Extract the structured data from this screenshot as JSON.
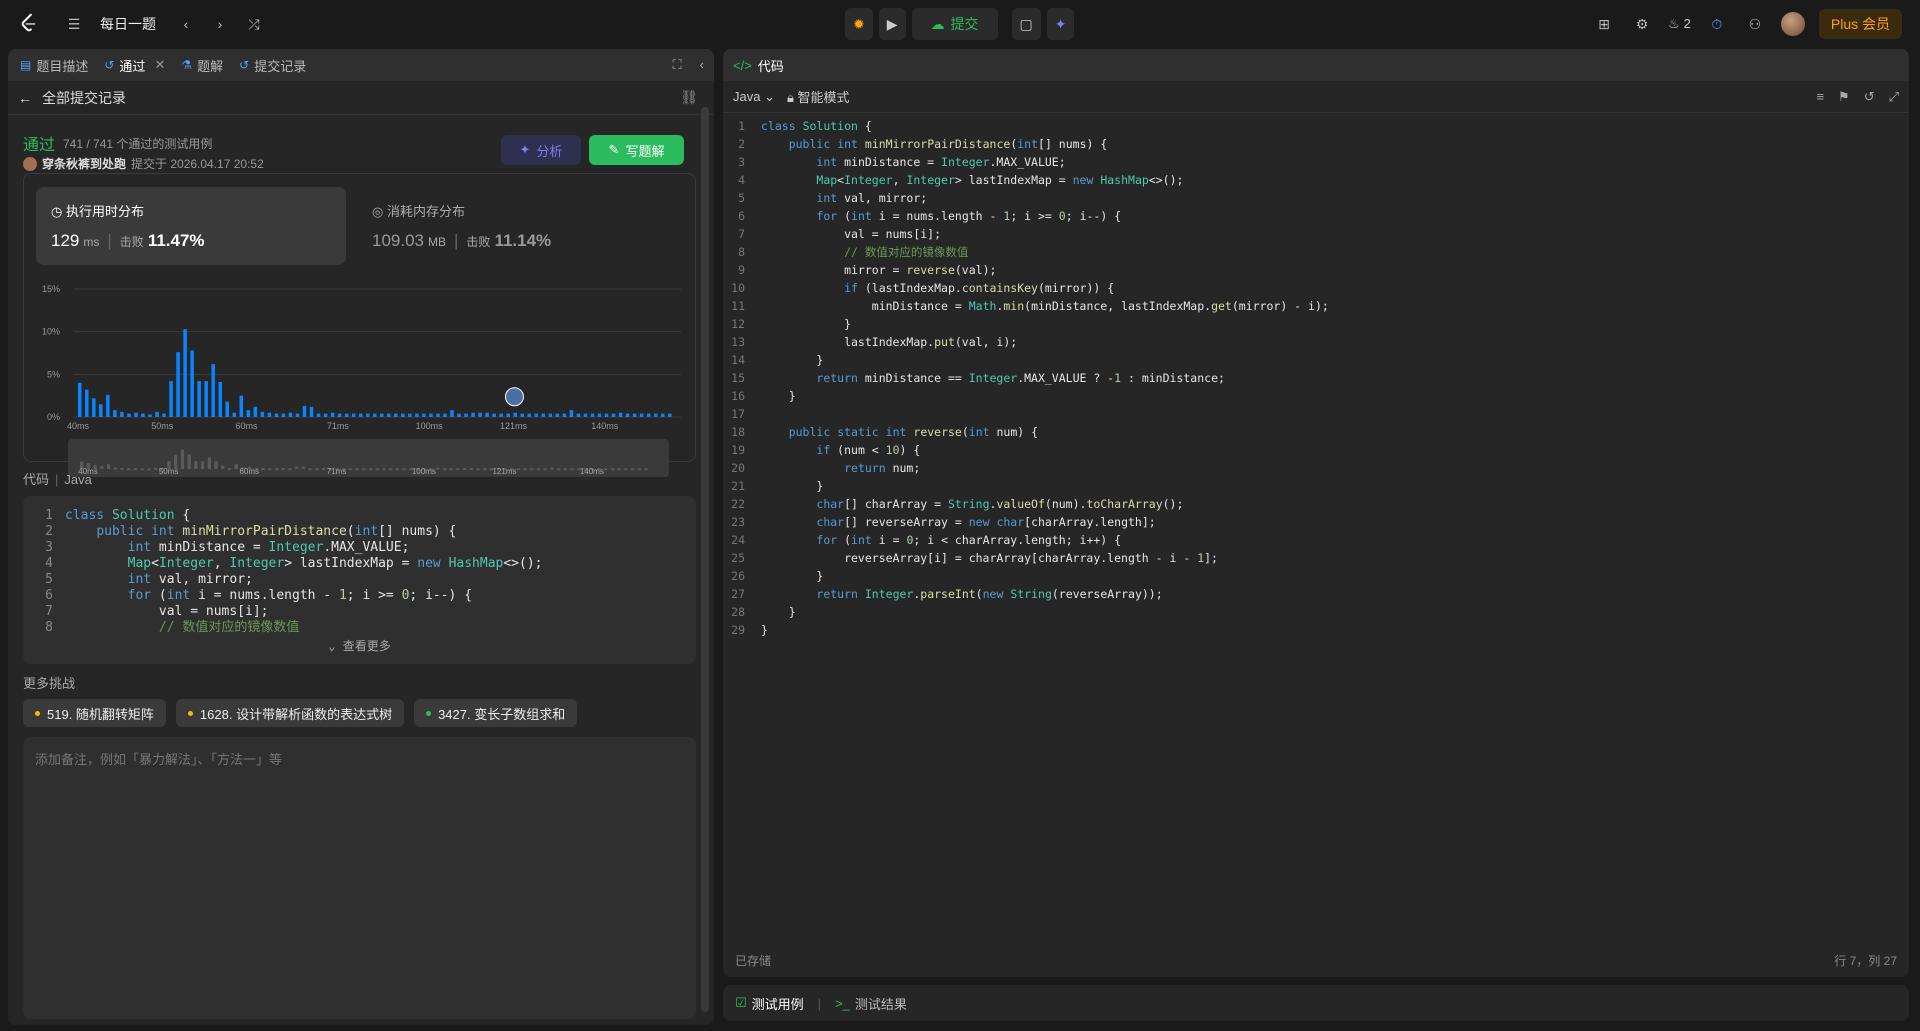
{
  "topbar": {
    "title": "每日一题",
    "submit_label": "提交",
    "streak": "2",
    "plus_label": "Plus 会员"
  },
  "left_tabs": [
    "题目描述",
    "通过",
    "题解",
    "提交记录"
  ],
  "back_label": "全部提交记录",
  "result": {
    "status": "通过",
    "cases": "741 / 741 个通过的测试用例",
    "user": "穿条秋裤到处跑",
    "submitted": "提交于 2026.04.17 20:52",
    "analyze_label": "分析",
    "write_label": "写题解"
  },
  "runtime": {
    "label": "执行用时分布",
    "value": "129",
    "unit": "ms",
    "beats_label": "击败",
    "beats": "11.47%"
  },
  "memory": {
    "label": "消耗内存分布",
    "value": "109.03",
    "unit": "MB",
    "beats_label": "击败",
    "beats": "11.14%"
  },
  "chart_data": {
    "type": "bar",
    "ylabel_ticks": [
      "15%",
      "10%",
      "5%",
      "0%"
    ],
    "ylim": [
      0,
      15
    ],
    "x_ticks": [
      "40ms",
      "50ms",
      "60ms",
      "71ms",
      "100ms",
      "121ms",
      "140ms"
    ],
    "values": [
      4,
      3.2,
      2.2,
      1.5,
      2.6,
      0.8,
      0.6,
      0.4,
      0.5,
      0.4,
      0.3,
      0.6,
      0.4,
      4.2,
      7.6,
      10.3,
      7.8,
      4.2,
      4.2,
      6.2,
      4.1,
      1.8,
      0.5,
      2.5,
      0.8,
      1.2,
      0.6,
      0.5,
      0.4,
      0.4,
      0.5,
      0.4,
      1.3,
      1.2,
      0.4,
      0.4,
      0.5,
      0.4,
      0.4,
      0.4,
      0.4,
      0.4,
      0.4,
      0.4,
      0.4,
      0.4,
      0.4,
      0.4,
      0.4,
      0.4,
      0.4,
      0.4,
      0.4,
      0.8,
      0.4,
      0.4,
      0.5,
      0.5,
      0.5,
      0.4,
      0.4,
      0.4,
      0.5,
      0.4,
      0.4,
      0.4,
      0.4,
      0.4,
      0.4,
      0.4,
      0.8,
      0.4,
      0.4,
      0.4,
      0.4,
      0.4,
      0.4,
      0.5,
      0.4,
      0.4,
      0.4,
      0.4,
      0.4,
      0.4,
      0.4
    ],
    "marker_index": 62,
    "grid": true
  },
  "code_preview": {
    "heading": "代码",
    "lang": "Java",
    "more_label": "查看更多",
    "lines": [
      "class Solution {",
      "    public int minMirrorPairDistance(int[] nums) {",
      "        int minDistance = Integer.MAX_VALUE;",
      "        Map<Integer, Integer> lastIndexMap = new HashMap<>();",
      "        int val, mirror;",
      "        for (int i = nums.length - 1; i >= 0; i--) {",
      "            val = nums[i];",
      "            // 数值对应的镜像数值"
    ]
  },
  "challenges": {
    "heading": "更多挑战",
    "items": [
      {
        "label": "519. 随机翻转矩阵",
        "color": "#ffb800"
      },
      {
        "label": "1628. 设计带解析函数的表达式树",
        "color": "#ffb800"
      },
      {
        "label": "3427. 变长子数组求和",
        "color": "#2cbb5d"
      }
    ]
  },
  "notes_placeholder": "添加备注，例如「暴力解法」、「方法一」等",
  "editor": {
    "tab": "代码",
    "lang": "Java",
    "mode": "智能模式",
    "status": "已存储",
    "position": "行 7，列 27",
    "lines": [
      "class Solution {",
      "    public int minMirrorPairDistance(int[] nums) {",
      "        int minDistance = Integer.MAX_VALUE;",
      "        Map<Integer, Integer> lastIndexMap = new HashMap<>();",
      "        int val, mirror;",
      "        for (int i = nums.length - 1; i >= 0; i--) {",
      "            val = nums[i];",
      "            // 数值对应的镜像数值",
      "            mirror = reverse(val);",
      "            if (lastIndexMap.containsKey(mirror)) {",
      "                minDistance = Math.min(minDistance, lastIndexMap.get(mirror) - i);",
      "            }",
      "            lastIndexMap.put(val, i);",
      "        }",
      "        return minDistance == Integer.MAX_VALUE ? -1 : minDistance;",
      "    }",
      "",
      "    public static int reverse(int num) {",
      "        if (num < 10) {",
      "            return num;",
      "        }",
      "        char[] charArray = String.valueOf(num).toCharArray();",
      "        char[] reverseArray = new char[charArray.length];",
      "        for (int i = 0; i < charArray.length; i++) {",
      "            reverseArray[i] = charArray[charArray.length - i - 1];",
      "        }",
      "        return Integer.parseInt(new String(reverseArray));",
      "    }",
      "}"
    ]
  },
  "bottom_tabs": [
    "测试用例",
    "测试结果"
  ]
}
